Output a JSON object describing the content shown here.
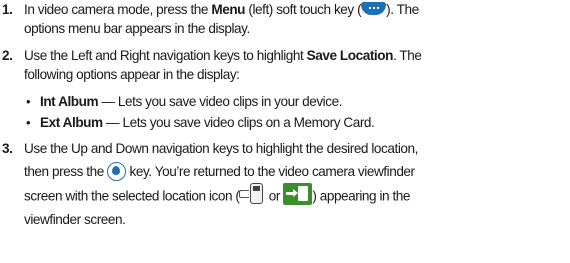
{
  "steps": [
    {
      "number": "1.",
      "line1_a": "In video camera mode, press the ",
      "line1_b": "Menu",
      "line1_c": " (left) soft touch key (",
      "line1_d": "). The",
      "line2": "options menu bar appears in the display."
    },
    {
      "number": "2.",
      "line1_a": "Use the Left and Right navigation keys to highlight ",
      "line1_b": "Save Location",
      "line1_c": ". The",
      "line2": "following options appear in the display:",
      "options": [
        {
          "bullet": "•",
          "name": "Int Album",
          "desc": " — Lets you save video clips in your device."
        },
        {
          "bullet": "•",
          "name": "Ext Album",
          "desc": " — Lets you save video clips on a Memory Card."
        }
      ]
    },
    {
      "number": "3.",
      "line1": "Use the Up and Down navigation keys to highlight the desired location,",
      "line2_a": "then press the ",
      "line2_b": " key. You’re returned to the video camera viewfinder",
      "line3_a": "screen with the selected location icon (",
      "line3_b": " or ",
      "line3_c": ") appearing in the",
      "line4": "viewfinder screen."
    }
  ],
  "icons": {
    "menu_key": "menu-soft-key-icon",
    "ok_key": "ok-key-icon",
    "int_location": "phone-location-icon",
    "ext_location": "memory-card-location-icon"
  },
  "colors": {
    "text": "#1a1a1a",
    "key_blue": "#1f6fb5",
    "card_green": "#3a8f2b"
  }
}
